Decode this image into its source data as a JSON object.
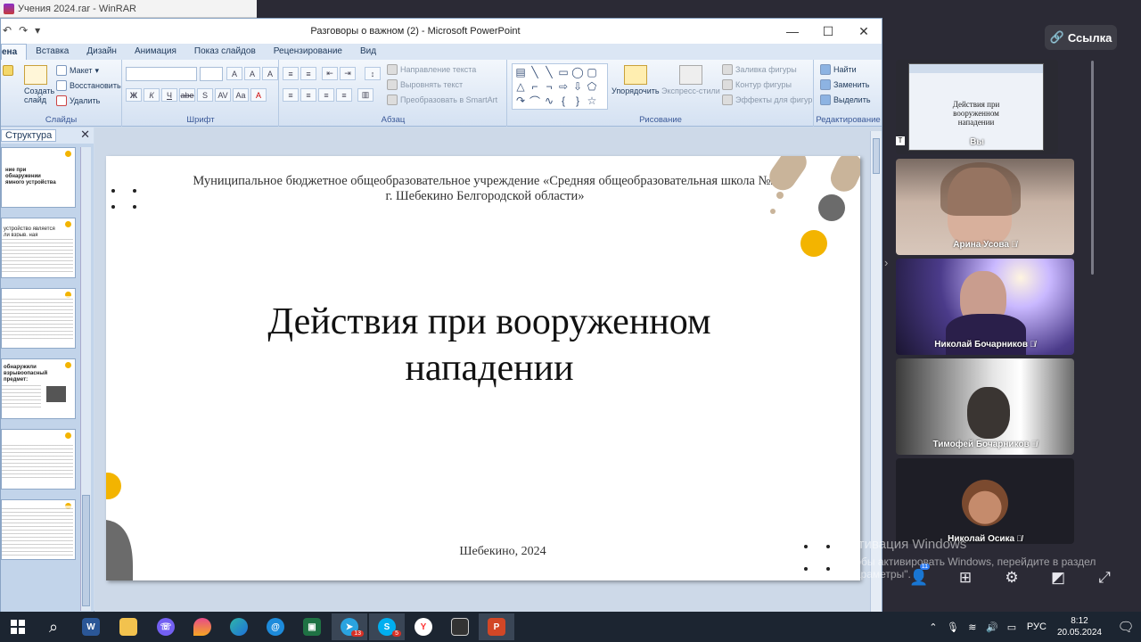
{
  "winrar": {
    "title": "Учения 2024.rar - WinRAR"
  },
  "ppt": {
    "window_title": "Разговоры о важном (2) - Microsoft PowerPoint",
    "controls": {
      "minimize": "—",
      "maximize": "☐",
      "close": "✕"
    },
    "qat": {
      "undo": "↶",
      "redo": "↷",
      "more": "▾"
    },
    "tabs": [
      "ена",
      "Вставка",
      "Дизайн",
      "Анимация",
      "Показ слайдов",
      "Рецензирование",
      "Вид"
    ],
    "ribbon": {
      "slides": {
        "label": "Слайды",
        "new_slide": "Создать слайд",
        "layout": "Макет",
        "reset": "Восстановить",
        "delete": "Удалить"
      },
      "font": {
        "label": "Шрифт",
        "bold": "Ж",
        "italic": "К",
        "underline": "Ч",
        "strike": "abe",
        "shadow": "S",
        "spacing": "AV",
        "case": "Aa",
        "grow": "A",
        "shrink": "A",
        "clear": "A"
      },
      "paragraph": {
        "label": "Абзац",
        "text_direction": "Направление текста",
        "align_text": "Выровнять текст",
        "smartart": "Преобразовать в SmartArt"
      },
      "drawing": {
        "label": "Рисование",
        "arrange": "Упорядочить",
        "quick_styles": "Экспресс-стили",
        "fill": "Заливка фигуры",
        "outline": "Контур фигуры",
        "effects": "Эффекты для фигур"
      },
      "editing": {
        "label": "Редактирование",
        "find": "Найти",
        "replace": "Заменить",
        "select": "Выделить"
      }
    },
    "panel": {
      "tab": "Структура",
      "close": "✕"
    },
    "thumbs": [
      {
        "title": "ние при обнаружении ямного устройства"
      },
      {
        "title": "устройство является ли взрыв. ная"
      },
      {
        "title": ""
      },
      {
        "title": "обнаружили взрывоопасный предмет:"
      },
      {
        "title": ""
      },
      {
        "title": ""
      }
    ],
    "slide": {
      "school": "Муниципальное бюджетное общеобразовательное учреждение «Средняя общеобразовательная школа №2 г. Шебекино Белгородской области»",
      "title_line1": "Действия при вооруженном",
      "title_line2": "нападении",
      "footer": "Шебекино, 2024"
    }
  },
  "conference": {
    "link_button": "Ссылка",
    "participants": [
      {
        "name": "Вы",
        "muted": false,
        "screen": true
      },
      {
        "name": "Арина Усова",
        "muted": true
      },
      {
        "name": "Николай Бочарников",
        "muted": true
      },
      {
        "name": "Тимофей Бочарников",
        "muted": true
      },
      {
        "name": "Николай Осика",
        "muted": true
      }
    ],
    "toolbar": {
      "participants_count": "11"
    },
    "activation": {
      "line1": "Активация Windows",
      "line2": "Чтобы активировать Windows, перейдите в раздел",
      "line3": "\"Параметры\"."
    }
  },
  "taskbar": {
    "apps": [
      "Windows",
      "Поиск",
      "Word",
      "Проводник",
      "Viber",
      "Paint",
      "Edge",
      "Mail",
      "Excel",
      "Telegram",
      "Skype",
      "Яндекс",
      "Monitor",
      "PowerPoint"
    ],
    "telegram_badge": "13",
    "skype_badge": "5",
    "lang": "РУС",
    "time": "8:12",
    "date": "20.05.2024"
  },
  "colors": {
    "accent_yellow": "#F3B400",
    "accent_gray": "#6B6B6B",
    "accent_tan": "#C9B49A",
    "taskbar": "#1C2531",
    "conference_bg": "#2B2A35"
  }
}
